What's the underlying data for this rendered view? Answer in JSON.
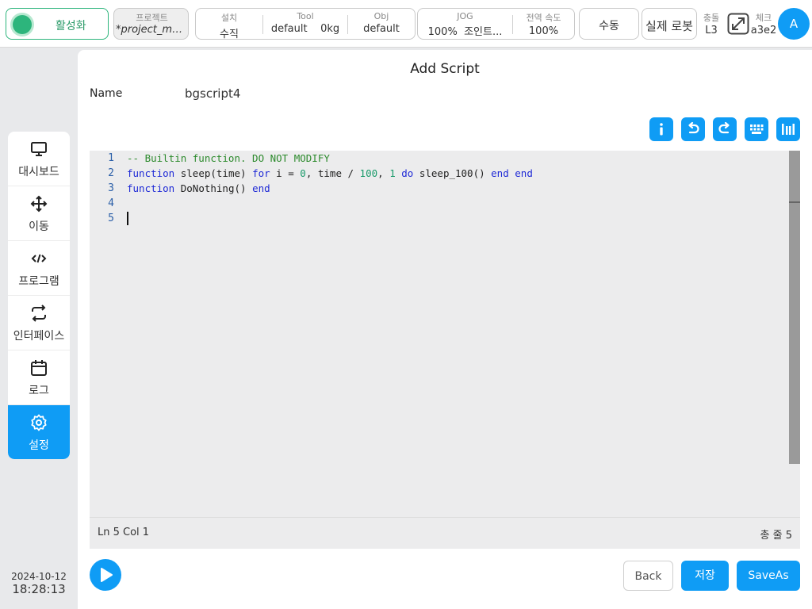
{
  "topbar": {
    "activate_label": "활성화",
    "project": {
      "title": "프로젝트",
      "value": "*project_mo..."
    },
    "install": {
      "title": "설치",
      "value": "수직",
      "tool_title": "Tool",
      "tool_value": "default",
      "weight_value": "0kg",
      "obj_title": "Obj",
      "obj_value": "default"
    },
    "jog": {
      "title": "JOG",
      "speed": "100%",
      "mode": "조인트...",
      "global_title": "전역 속도",
      "global_value": "100%"
    },
    "manual_label": "수동",
    "real_robot_label": "실제 로봇",
    "collision": {
      "title": "충돌",
      "value": "L3"
    },
    "check": {
      "title": "체크",
      "value": "a3e2"
    },
    "avatar_letter": "A"
  },
  "sidebar": {
    "items": [
      {
        "label": "대시보드",
        "icon": "monitor-icon"
      },
      {
        "label": "이동",
        "icon": "move-icon"
      },
      {
        "label": "프로그램",
        "icon": "code-icon"
      },
      {
        "label": "인터페이스",
        "icon": "swap-icon"
      },
      {
        "label": "로그",
        "icon": "calendar-icon"
      },
      {
        "label": "설정",
        "icon": "gear-icon"
      }
    ],
    "date": "2024-10-12",
    "time": "18:28:13"
  },
  "main": {
    "title": "Add Script",
    "name_label": "Name",
    "name_value": "bgscript4",
    "editor": {
      "line_numbers": [
        "1",
        "2",
        "3",
        "4",
        "5"
      ],
      "line1": {
        "comment": "-- Builtin function. DO NOT MODIFY"
      },
      "line2": {
        "kw_function": "function",
        "t1": " sleep(time) ",
        "kw_for": "for",
        "t2": " i = ",
        "n0": "0",
        "t3": ", time / ",
        "n100": "100",
        "t4": ", ",
        "n1": "1",
        "t5": " ",
        "kw_do": "do",
        "t6": " sleep_100() ",
        "kw_end1": "end",
        "t7": " ",
        "kw_end2": "end"
      },
      "line3": {
        "kw_function": "function",
        "t1": " DoNothing() ",
        "kw_end": "end"
      }
    },
    "status_left": "Ln 5 Col 1",
    "status_right": "총 줄 5",
    "buttons": {
      "back": "Back",
      "save": "저장",
      "saveas": "SaveAs"
    }
  }
}
